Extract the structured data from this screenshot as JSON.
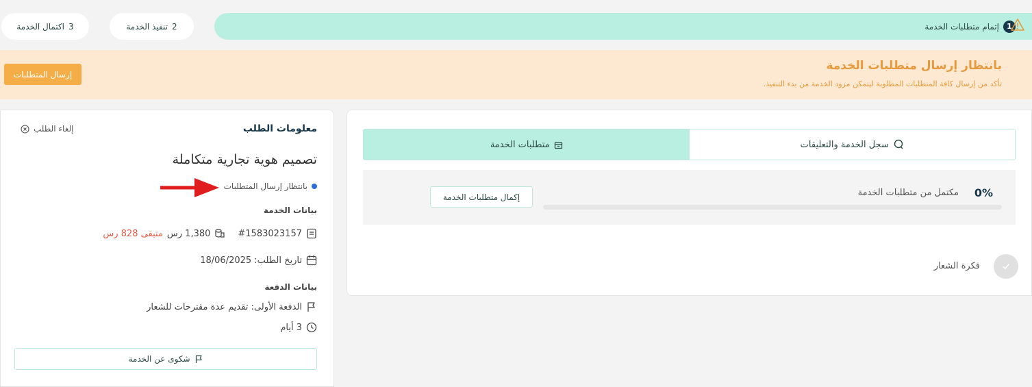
{
  "steps": [
    {
      "num": "1",
      "label": "إتمام متطلبات الخدمة"
    },
    {
      "num": "2",
      "label": "تنفيذ الخدمة"
    },
    {
      "num": "3",
      "label": "اكتمال الخدمة"
    }
  ],
  "banner": {
    "title": "بانتظار إرسال متطلبات الخدمة",
    "subtitle": "تأكد من إرسال كافة المتطلبات المطلوبة ليتمكن مزود الخدمة من بدء التنفيذ.",
    "button": "إرسال المتطلبات",
    "accent": "#e69a3c"
  },
  "tabs": [
    {
      "label": "سجل الخدمة والتعليقات",
      "icon": "chat-icon",
      "active": false
    },
    {
      "label": "متطلبات الخدمة",
      "icon": "box-icon",
      "active": true
    }
  ],
  "progress": {
    "percent_text": "0%",
    "label": "مكتمل من متطلبات الخدمة",
    "value": 0,
    "complete_button": "إكمال متطلبات الخدمة"
  },
  "requirements": [
    {
      "label": "فكرة الشعار",
      "done": false
    }
  ],
  "order": {
    "section_title": "معلومات الطلب",
    "cancel_label": "إلغاء الطلب",
    "name": "تصميم هوية تجارية متكاملة",
    "status": "بانتظار إرسال المتطلبات",
    "service_data_label": "بيانات الخدمة",
    "order_id": "#1583023157",
    "price": "1,380 رس",
    "remaining": "متبقى 828 رس",
    "date": "تاريخ الطلب: 18/06/2025",
    "payment_label": "بيانات الدفعة",
    "payment_desc": "الدفعة الأولى: تقديم عدة مقترحات للشعار",
    "duration": "3 أيام",
    "complaint_button": "شكوى عن الخدمة"
  }
}
